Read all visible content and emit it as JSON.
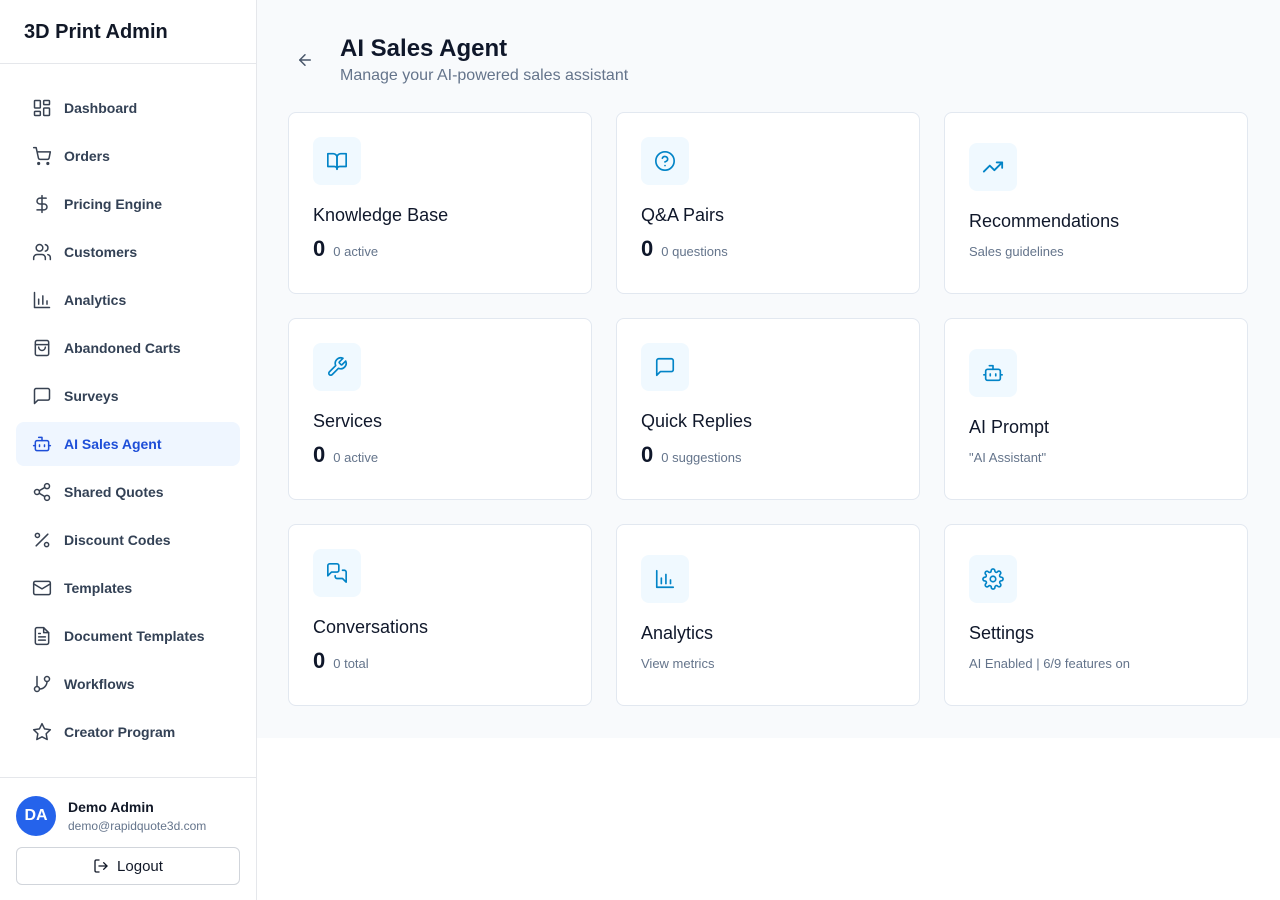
{
  "app": {
    "title": "3D Print Admin"
  },
  "sidebar": {
    "items": [
      {
        "label": "Dashboard",
        "icon": "dashboard-icon"
      },
      {
        "label": "Orders",
        "icon": "cart-icon"
      },
      {
        "label": "Pricing Engine",
        "icon": "dollar-icon"
      },
      {
        "label": "Customers",
        "icon": "users-icon"
      },
      {
        "label": "Analytics",
        "icon": "bar-chart-icon"
      },
      {
        "label": "Abandoned Carts",
        "icon": "shopping-bag-icon"
      },
      {
        "label": "Surveys",
        "icon": "message-square-icon"
      },
      {
        "label": "AI Sales Agent",
        "icon": "bot-icon",
        "active": true
      },
      {
        "label": "Shared Quotes",
        "icon": "share-icon"
      },
      {
        "label": "Discount Codes",
        "icon": "percent-icon"
      },
      {
        "label": "Templates",
        "icon": "mail-icon"
      },
      {
        "label": "Document Templates",
        "icon": "file-text-icon"
      },
      {
        "label": "Workflows",
        "icon": "git-branch-icon"
      },
      {
        "label": "Creator Program",
        "icon": "star-icon"
      }
    ]
  },
  "user": {
    "initials": "DA",
    "name": "Demo Admin",
    "email": "demo@rapidquote3d.com",
    "logout_label": "Logout"
  },
  "page": {
    "title": "AI Sales Agent",
    "subtitle": "Manage your AI-powered sales assistant"
  },
  "cards": [
    {
      "title": "Knowledge Base",
      "count": "0",
      "count_label": "0 active",
      "icon": "book-open-icon"
    },
    {
      "title": "Q&A Pairs",
      "count": "0",
      "count_label": "0 questions",
      "icon": "help-circle-icon"
    },
    {
      "title": "Recommendations",
      "description": "Sales guidelines",
      "icon": "trending-up-icon"
    },
    {
      "title": "Services",
      "count": "0",
      "count_label": "0 active",
      "icon": "wrench-icon"
    },
    {
      "title": "Quick Replies",
      "count": "0",
      "count_label": "0 suggestions",
      "icon": "message-square-icon"
    },
    {
      "title": "AI Prompt",
      "description": "\"AI Assistant\"",
      "icon": "bot-icon"
    },
    {
      "title": "Conversations",
      "count": "0",
      "count_label": "0 total",
      "icon": "messages-icon"
    },
    {
      "title": "Analytics",
      "description": "View metrics",
      "icon": "bar-chart-icon"
    },
    {
      "title": "Settings",
      "description": "AI Enabled | 6/9 features on",
      "icon": "settings-icon"
    }
  ],
  "colors": {
    "accent": "#0284c7",
    "active_nav_bg": "#eff6ff",
    "active_nav_text": "#1d4ed8",
    "avatar_bg": "#2563eb"
  }
}
